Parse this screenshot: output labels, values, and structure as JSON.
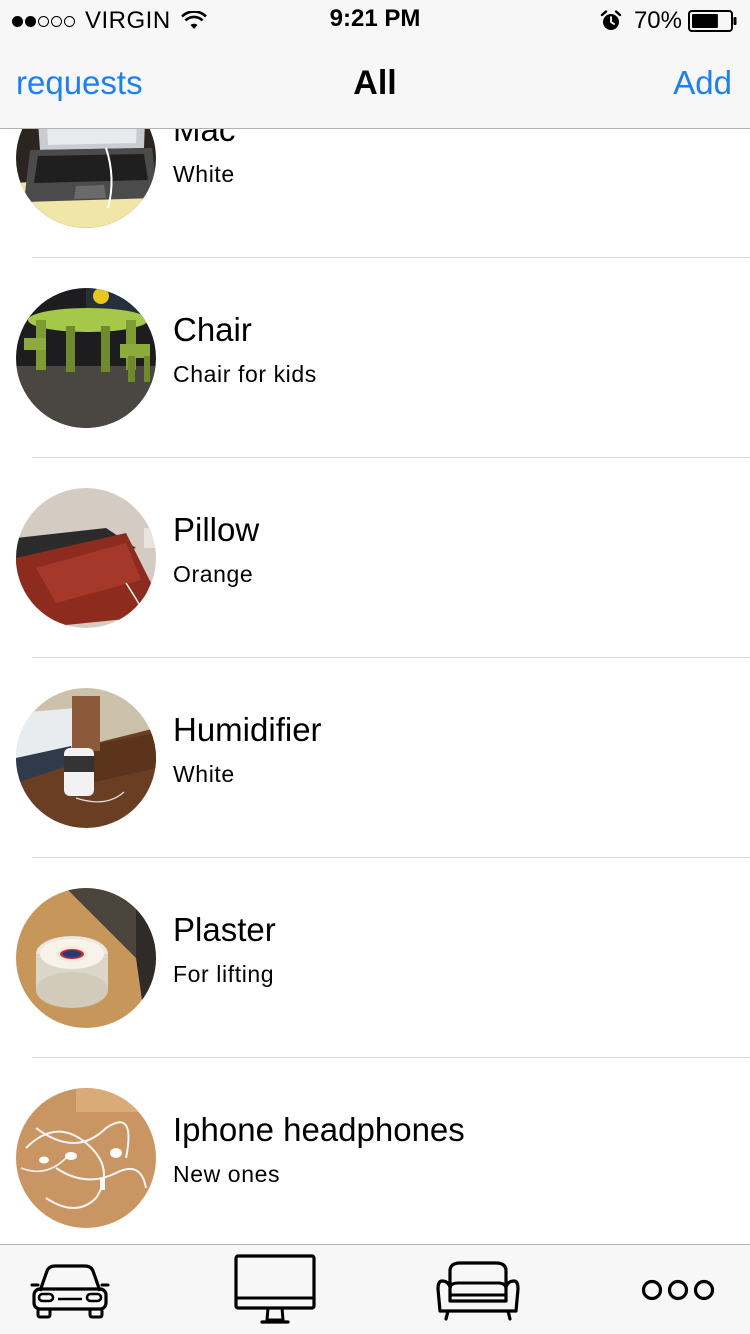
{
  "status_bar": {
    "carrier": "VIRGIN",
    "signal_bars_filled": 2,
    "signal_bars_total": 5,
    "time": "9:21 PM",
    "battery_percent": "70%",
    "battery_level": 0.7,
    "icons": [
      "signal-dots",
      "wifi-icon",
      "alarm-icon",
      "battery-icon"
    ]
  },
  "nav": {
    "left_label": "requests",
    "title": "All",
    "right_label": "Add",
    "accent_color": "#1e7ff0"
  },
  "items": [
    {
      "title": "Mac",
      "subtitle": "White",
      "image": "laptop-photo"
    },
    {
      "title": "Chair",
      "subtitle": "Chair for kids",
      "image": "kids-table-chairs-photo"
    },
    {
      "title": "Pillow",
      "subtitle": "Orange",
      "image": "red-pillow-photo"
    },
    {
      "title": "Humidifier",
      "subtitle": "White",
      "image": "humidifier-photo"
    },
    {
      "title": "Plaster",
      "subtitle": "For lifting",
      "image": "tape-roll-photo"
    },
    {
      "title": "Iphone headphones",
      "subtitle": "New ones",
      "image": "earphones-photo"
    }
  ],
  "tab_bar": {
    "tabs": [
      {
        "icon": "car-icon"
      },
      {
        "icon": "monitor-icon"
      },
      {
        "icon": "sofa-icon"
      },
      {
        "icon": "more-icon"
      }
    ]
  }
}
